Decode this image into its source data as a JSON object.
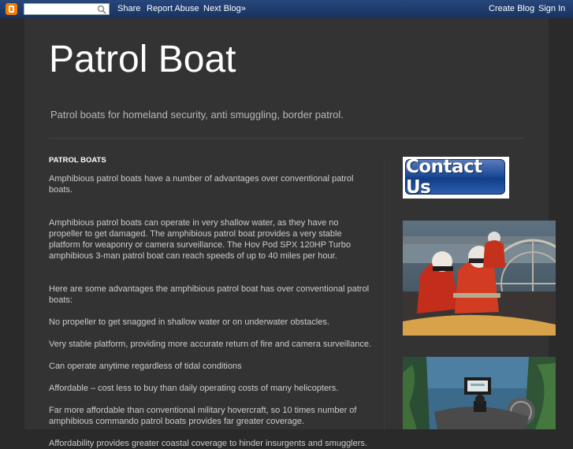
{
  "navbar": {
    "logo_icon": "blogger-logo-icon",
    "search_placeholder": "",
    "share": "Share",
    "report_abuse": "Report Abuse",
    "next_blog": "Next Blog»",
    "create_blog": "Create Blog",
    "sign_in": "Sign In"
  },
  "header": {
    "title": "Patrol Boat",
    "description": "Patrol boats for homeland security, anti smuggling, border patrol."
  },
  "post": {
    "title": "PATROL BOATS",
    "paragraphs": [
      "Amphibious patrol boats have a number of advantages over conventional patrol boats.",
      "Amphibious patrol boats can operate in very shallow water, as they have no propeller to get damaged. The amphibious patrol boat provides a very stable platform for weaponry or camera surveillance. The Hov Pod SPX 120HP Turbo amphibious 3-man patrol boat can reach speeds of up to 40 miles per hour.",
      "Here are some advantages the amphibious patrol boat has over conventional patrol boats:",
      "No propeller to get snagged in shallow water or on underwater obstacles.",
      "Very stable platform, providing more accurate return of fire and camera surveillance.",
      "Can operate anytime regardless of tidal conditions",
      "Affordable – cost less to buy than daily operating costs of many helicopters.",
      "Far more affordable than conventional military hovercraft, so 10 times number of amphibious commando patrol boats provides far greater coverage.",
      "Affordability provides greater coastal coverage to hinder insurgents and smugglers."
    ]
  },
  "sidebar": {
    "contact_label": "Contact Us"
  },
  "colors": {
    "navbar": "#1c3a63",
    "background": "#2a2a2a",
    "content": "#333333",
    "logo": "#f57d00"
  }
}
